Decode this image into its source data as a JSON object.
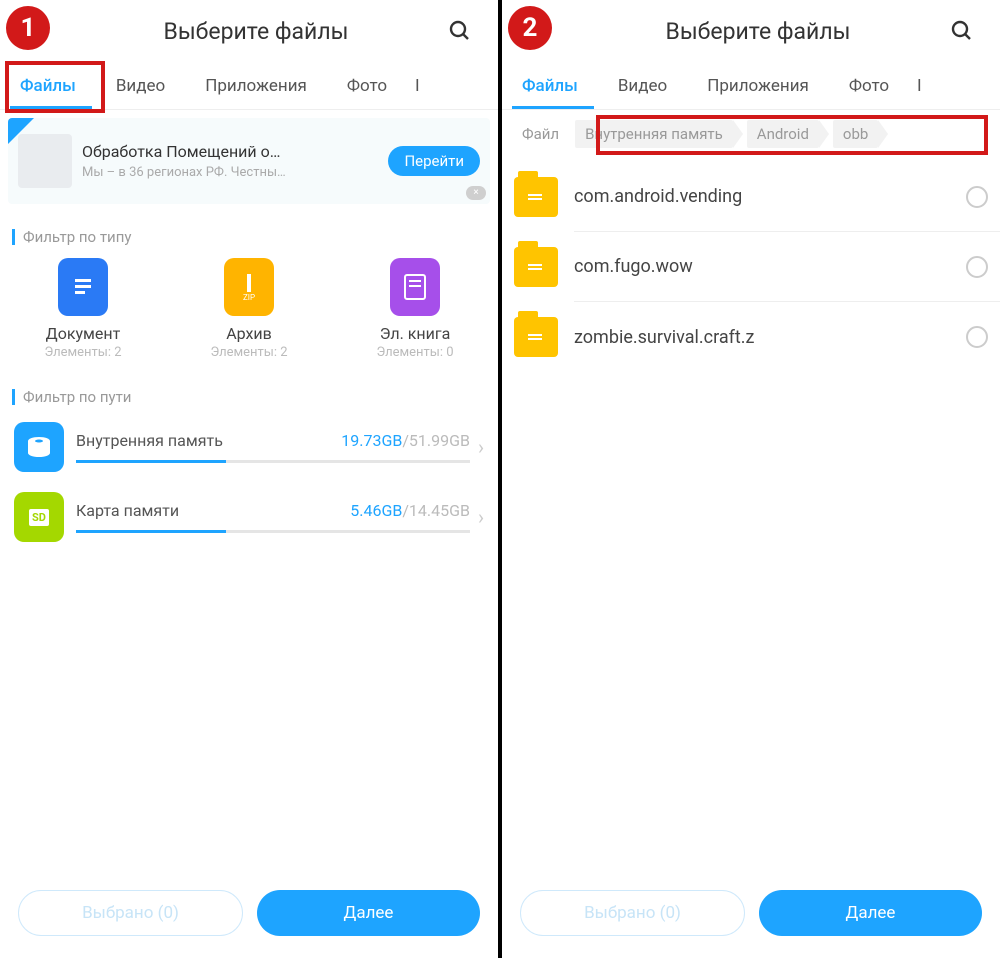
{
  "steps": [
    "1",
    "2"
  ],
  "header": {
    "title": "Выберите файлы"
  },
  "tabs": [
    "Файлы",
    "Видео",
    "Приложения",
    "Фото"
  ],
  "tab_extra": "I",
  "pane1": {
    "ad": {
      "title": "Обработка Помещений о…",
      "subtitle": "Мы – в 36 регионах РФ. Честны…",
      "cta": "Перейти"
    },
    "filter_type_heading": "Фильтр по типу",
    "types": [
      {
        "label": "Документ",
        "count": "Элементы: 2",
        "icon": "document"
      },
      {
        "label": "Архив",
        "count": "Элементы: 2",
        "icon": "zip"
      },
      {
        "label": "Эл. книга",
        "count": "Элементы: 0",
        "icon": "ebook"
      }
    ],
    "filter_path_heading": "Фильтр по пути",
    "storage": [
      {
        "name": "Внутренняя память",
        "used": "19.73GB",
        "total": "51.99GB",
        "fill_pct": 38,
        "icon": "internal"
      },
      {
        "name": "Карта памяти",
        "used": "5.46GB",
        "total": "14.45GB",
        "fill_pct": 38,
        "icon": "sd"
      }
    ]
  },
  "pane2": {
    "breadcrumb": [
      "Файл",
      "Внутренняя память",
      "Android",
      "obb"
    ],
    "folders": [
      "com.android.vending",
      "com.fugo.wow",
      "zombie.survival.craft.z"
    ]
  },
  "bottom": {
    "selected": "Выбрано (0)",
    "next": "Далее"
  },
  "icons": {
    "sd_label": "SD"
  }
}
